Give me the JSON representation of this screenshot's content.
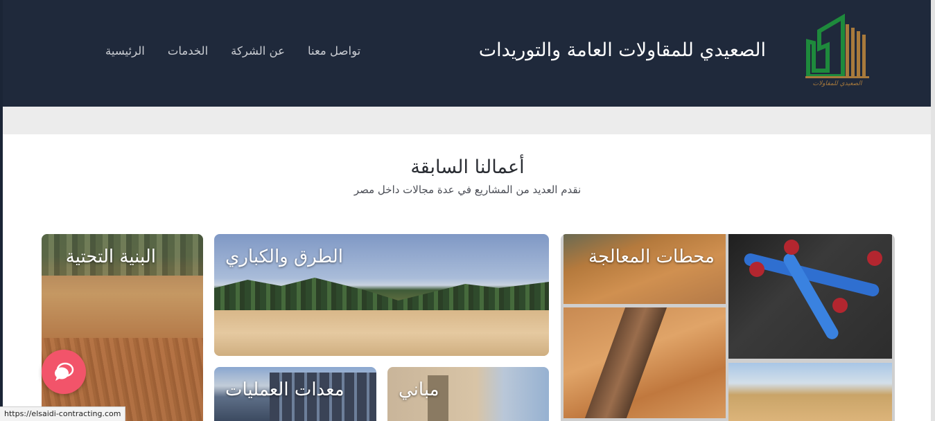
{
  "header": {
    "brand_title": "الصعيدي للمقاولات العامة والتوريدات",
    "logo_text": "الصعيدي للمقاولات",
    "nav": [
      {
        "label": "الرئيسية"
      },
      {
        "label": "الخدمات"
      },
      {
        "label": "عن الشركة"
      },
      {
        "label": "تواصل معنا"
      }
    ]
  },
  "section": {
    "title": "أعمالنا السابقة",
    "subtitle": "نقدم العديد من المشاريع في عدة مجالات داخل مصر"
  },
  "cards": {
    "infrastructure": "البنية التحتية",
    "roads": "الطرق والكباري",
    "treatment": "محطات المعالجة",
    "equipment": "معدات العمليات",
    "buildings": "مباني"
  },
  "status_bar": {
    "url": "https://elsaidi-contracting.com"
  },
  "colors": {
    "header_bg": "#1f293b",
    "chat_button": "#f2546a",
    "logo_green": "#1e8a3c",
    "logo_gold": "#a87a3c"
  },
  "icons": {
    "chat": "chat-bubble-icon",
    "logo": "building-logo-icon"
  }
}
